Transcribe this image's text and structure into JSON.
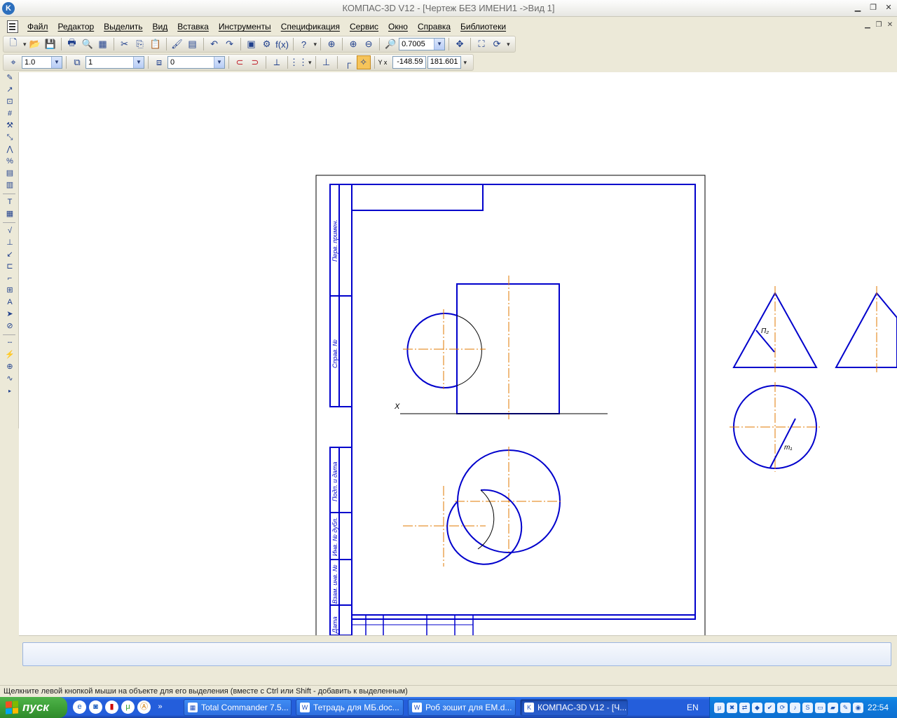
{
  "window": {
    "app_icon": "K",
    "title": "КОМПАС-3D V12 - [Чертеж БЕЗ ИМЕНИ1 ->Вид 1]"
  },
  "menu": {
    "items": [
      "Файл",
      "Редактор",
      "Выделить",
      "Вид",
      "Вставка",
      "Инструменты",
      "Спецификация",
      "Сервис",
      "Окно",
      "Справка",
      "Библиотеки"
    ]
  },
  "toolbar_standard": {
    "zoom_value": "0.7005",
    "fx_label": "f(x)"
  },
  "toolbar_current_state": {
    "step_value": "1.0",
    "layer_value": "1",
    "style_value": "0",
    "coord_label": "Y x",
    "coord_x": "-148.59",
    "coord_y": "181.601"
  },
  "drawing": {
    "axis_label": "X",
    "label_pi": "П₂",
    "label_m": "m₁",
    "stamp_labels": [
      "Перв. примен.",
      "Справ. №",
      "Подп. и дата",
      "Инв. № дубл.",
      "Взам. инв. №",
      "Дата"
    ]
  },
  "status": {
    "hint": "Щелкните левой кнопкой мыши на объекте для его выделения (вместе с Ctrl или Shift - добавить к выделенным)"
  },
  "taskbar": {
    "start_label": "пуск",
    "tasks": [
      {
        "label": "Total Commander 7.5..."
      },
      {
        "label": "Тетрадь для МБ.doc..."
      },
      {
        "label": "Роб зошит для ЕМ.d..."
      },
      {
        "label": "КОМПАС-3D V12 - [Ч..."
      }
    ],
    "language": "EN",
    "clock": "22:54"
  },
  "colors": {
    "geometry": "#0000cc",
    "axis": "#e07800",
    "thin": "#000000"
  }
}
